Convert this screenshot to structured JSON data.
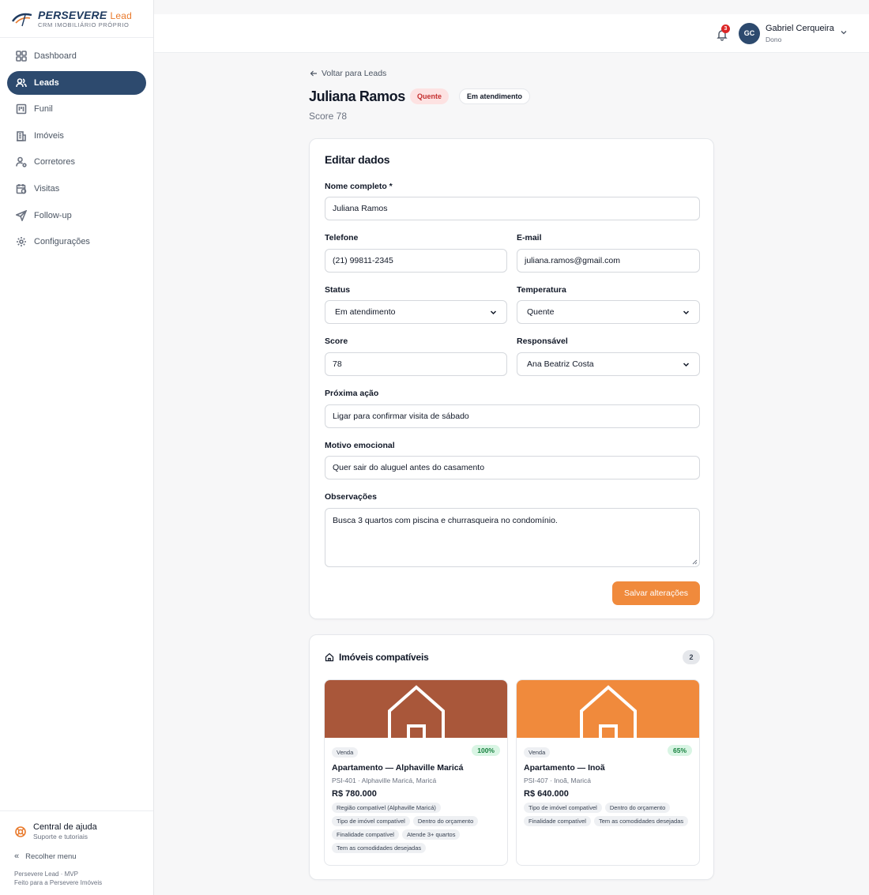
{
  "brand": {
    "name": "PERSEVERE",
    "name_suffix": "Lead",
    "subtitle": "CRM IMOBILIÁRIO PRÓPRIO"
  },
  "sidebar": {
    "items": [
      {
        "label": "Dashboard",
        "icon": "dashboard-icon"
      },
      {
        "label": "Leads",
        "icon": "users-icon",
        "active": true
      },
      {
        "label": "Funil",
        "icon": "funnel-icon"
      },
      {
        "label": "Imóveis",
        "icon": "building-icon"
      },
      {
        "label": "Corretores",
        "icon": "user-settings-icon"
      },
      {
        "label": "Visitas",
        "icon": "calendar-clock-icon"
      },
      {
        "label": "Follow-up",
        "icon": "send-icon"
      },
      {
        "label": "Configurações",
        "icon": "gear-icon"
      }
    ],
    "help_title": "Central de ajuda",
    "help_subtitle": "Suporte e tutoriais",
    "collapse_label": "Recolher menu",
    "footer_line1": "Persevere Lead · MVP",
    "footer_line2": "Feito para a Persevere Imóveis"
  },
  "topbar": {
    "notification_count": "3",
    "avatar_initials": "GC",
    "user_name": "Gabriel Cerqueira",
    "user_role": "Dono"
  },
  "lead": {
    "back_label": "Voltar para Leads",
    "name": "Juliana Ramos",
    "temperature_badge": "Quente",
    "status_badge": "Em atendimento",
    "score_line": "Score 78"
  },
  "form": {
    "title": "Editar dados",
    "name_label": "Nome completo *",
    "name_value": "Juliana Ramos",
    "phone_label": "Telefone",
    "phone_value": "(21) 99811-2345",
    "email_label": "E-mail",
    "email_value": "juliana.ramos@gmail.com",
    "status_label": "Status",
    "status_value": "Em atendimento",
    "temperature_label": "Temperatura",
    "temperature_value": "Quente",
    "score_label": "Score",
    "score_value": "78",
    "owner_label": "Responsável",
    "owner_value": "Ana Beatriz Costa",
    "next_action_label": "Próxima ação",
    "next_action_value": "Ligar para confirmar visita de sábado",
    "motive_label": "Motivo emocional",
    "motive_value": "Quer sair do aluguel antes do casamento",
    "notes_label": "Observações",
    "notes_value": "Busca 3 quartos com piscina e churrasqueira no condomínio.",
    "save_label": "Salvar alterações"
  },
  "properties": {
    "title": "Imóveis compatíveis",
    "count": "2",
    "items": [
      {
        "type": "Venda",
        "match": "100%",
        "name": "Apartamento — Alphaville Maricá",
        "code": "PSI-401 · Alphaville Maricá, Maricá",
        "price": "R$ 780.000",
        "image_color": "#a9573a",
        "tags": [
          "Região compatível (Alphaville Maricá)",
          "Tipo de imóvel compatível",
          "Dentro do orçamento",
          "Finalidade compatível",
          "Atende 3+ quartos",
          "Tem as comodidades desejadas"
        ]
      },
      {
        "type": "Venda",
        "match": "65%",
        "name": "Apartamento — Inoã",
        "code": "PSI-407 · Inoã, Maricá",
        "price": "R$ 640.000",
        "image_color": "#f08a3c",
        "tags": [
          "Tipo de imóvel compatível",
          "Dentro do orçamento",
          "Finalidade compatível",
          "Tem as comodidades desejadas"
        ]
      }
    ]
  },
  "colors": {
    "accent": "#2d4a6e",
    "orange": "#f08a3c",
    "hot_badge_bg": "#fde2e2",
    "match_bg": "#d9f5e4"
  }
}
